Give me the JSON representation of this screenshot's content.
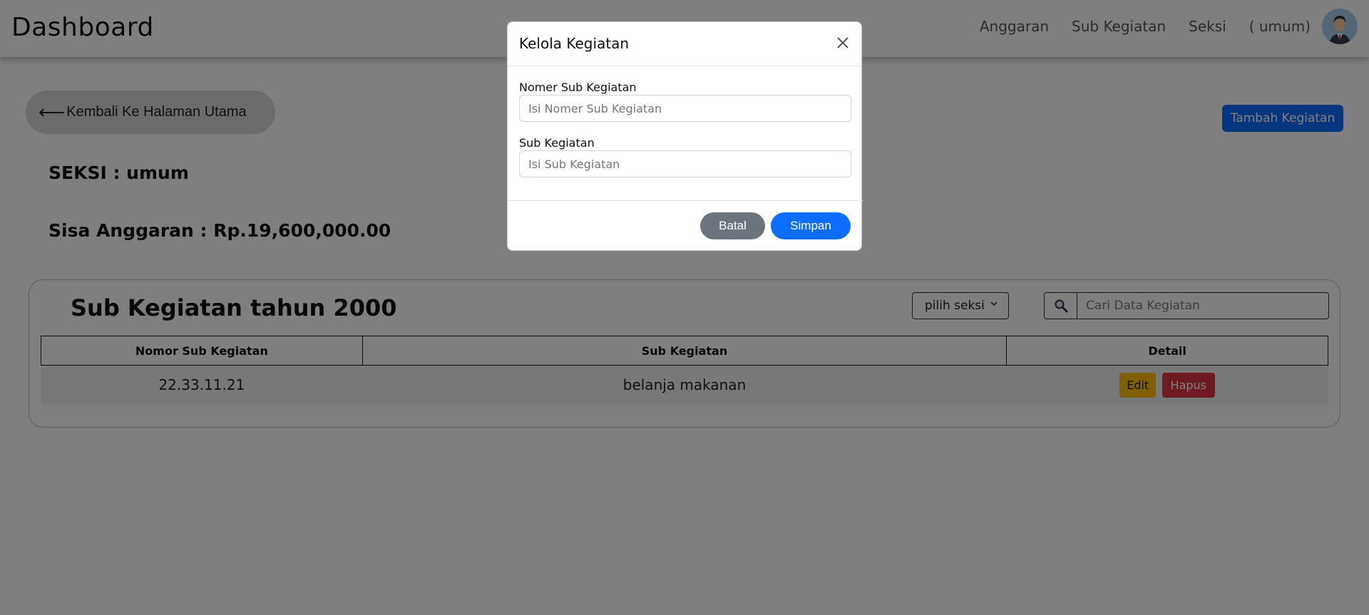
{
  "navbar": {
    "brand": "Dashboard",
    "links": [
      "Anggaran",
      "Sub Kegiatan",
      "Seksi"
    ],
    "user_label": "( umum)"
  },
  "back_button": {
    "arrow": "⟵",
    "label": "Kembali Ke Halaman Utama"
  },
  "add_button": {
    "label": "Tambah Kegiatan"
  },
  "info": {
    "seksi": "SEKSI : umum",
    "sisa_anggaran": "Sisa Anggaran : Rp.19,600,000.00"
  },
  "card": {
    "title": "Sub Kegiatan tahun 2000",
    "select": {
      "selected": "pilih seksi"
    },
    "search": {
      "placeholder": "Cari Data Kegiatan",
      "icon": "search-icon"
    },
    "table": {
      "headers": [
        "Nomor Sub Kegiatan",
        "Sub Kegiatan",
        "Detail"
      ],
      "rows": [
        {
          "nomor": "22.33.11.21",
          "sub_kegiatan": "belanja makanan",
          "edit_label": "Edit",
          "hapus_label": "Hapus"
        }
      ]
    }
  },
  "modal": {
    "title": "Kelola Kegiatan",
    "close_icon": "close-icon",
    "fields": [
      {
        "label": "Nomer Sub Kegiatan",
        "placeholder": "Isi Nomer Sub Kegiatan",
        "value": ""
      },
      {
        "label": "Sub Kegiatan",
        "placeholder": "Isi Sub Kegiatan",
        "value": ""
      }
    ],
    "cancel_label": "Batal",
    "save_label": "Simpan"
  },
  "colors": {
    "primary": "#0d6efd",
    "secondary": "#6c757d",
    "warning": "#ffc107",
    "danger": "#dc3545"
  }
}
